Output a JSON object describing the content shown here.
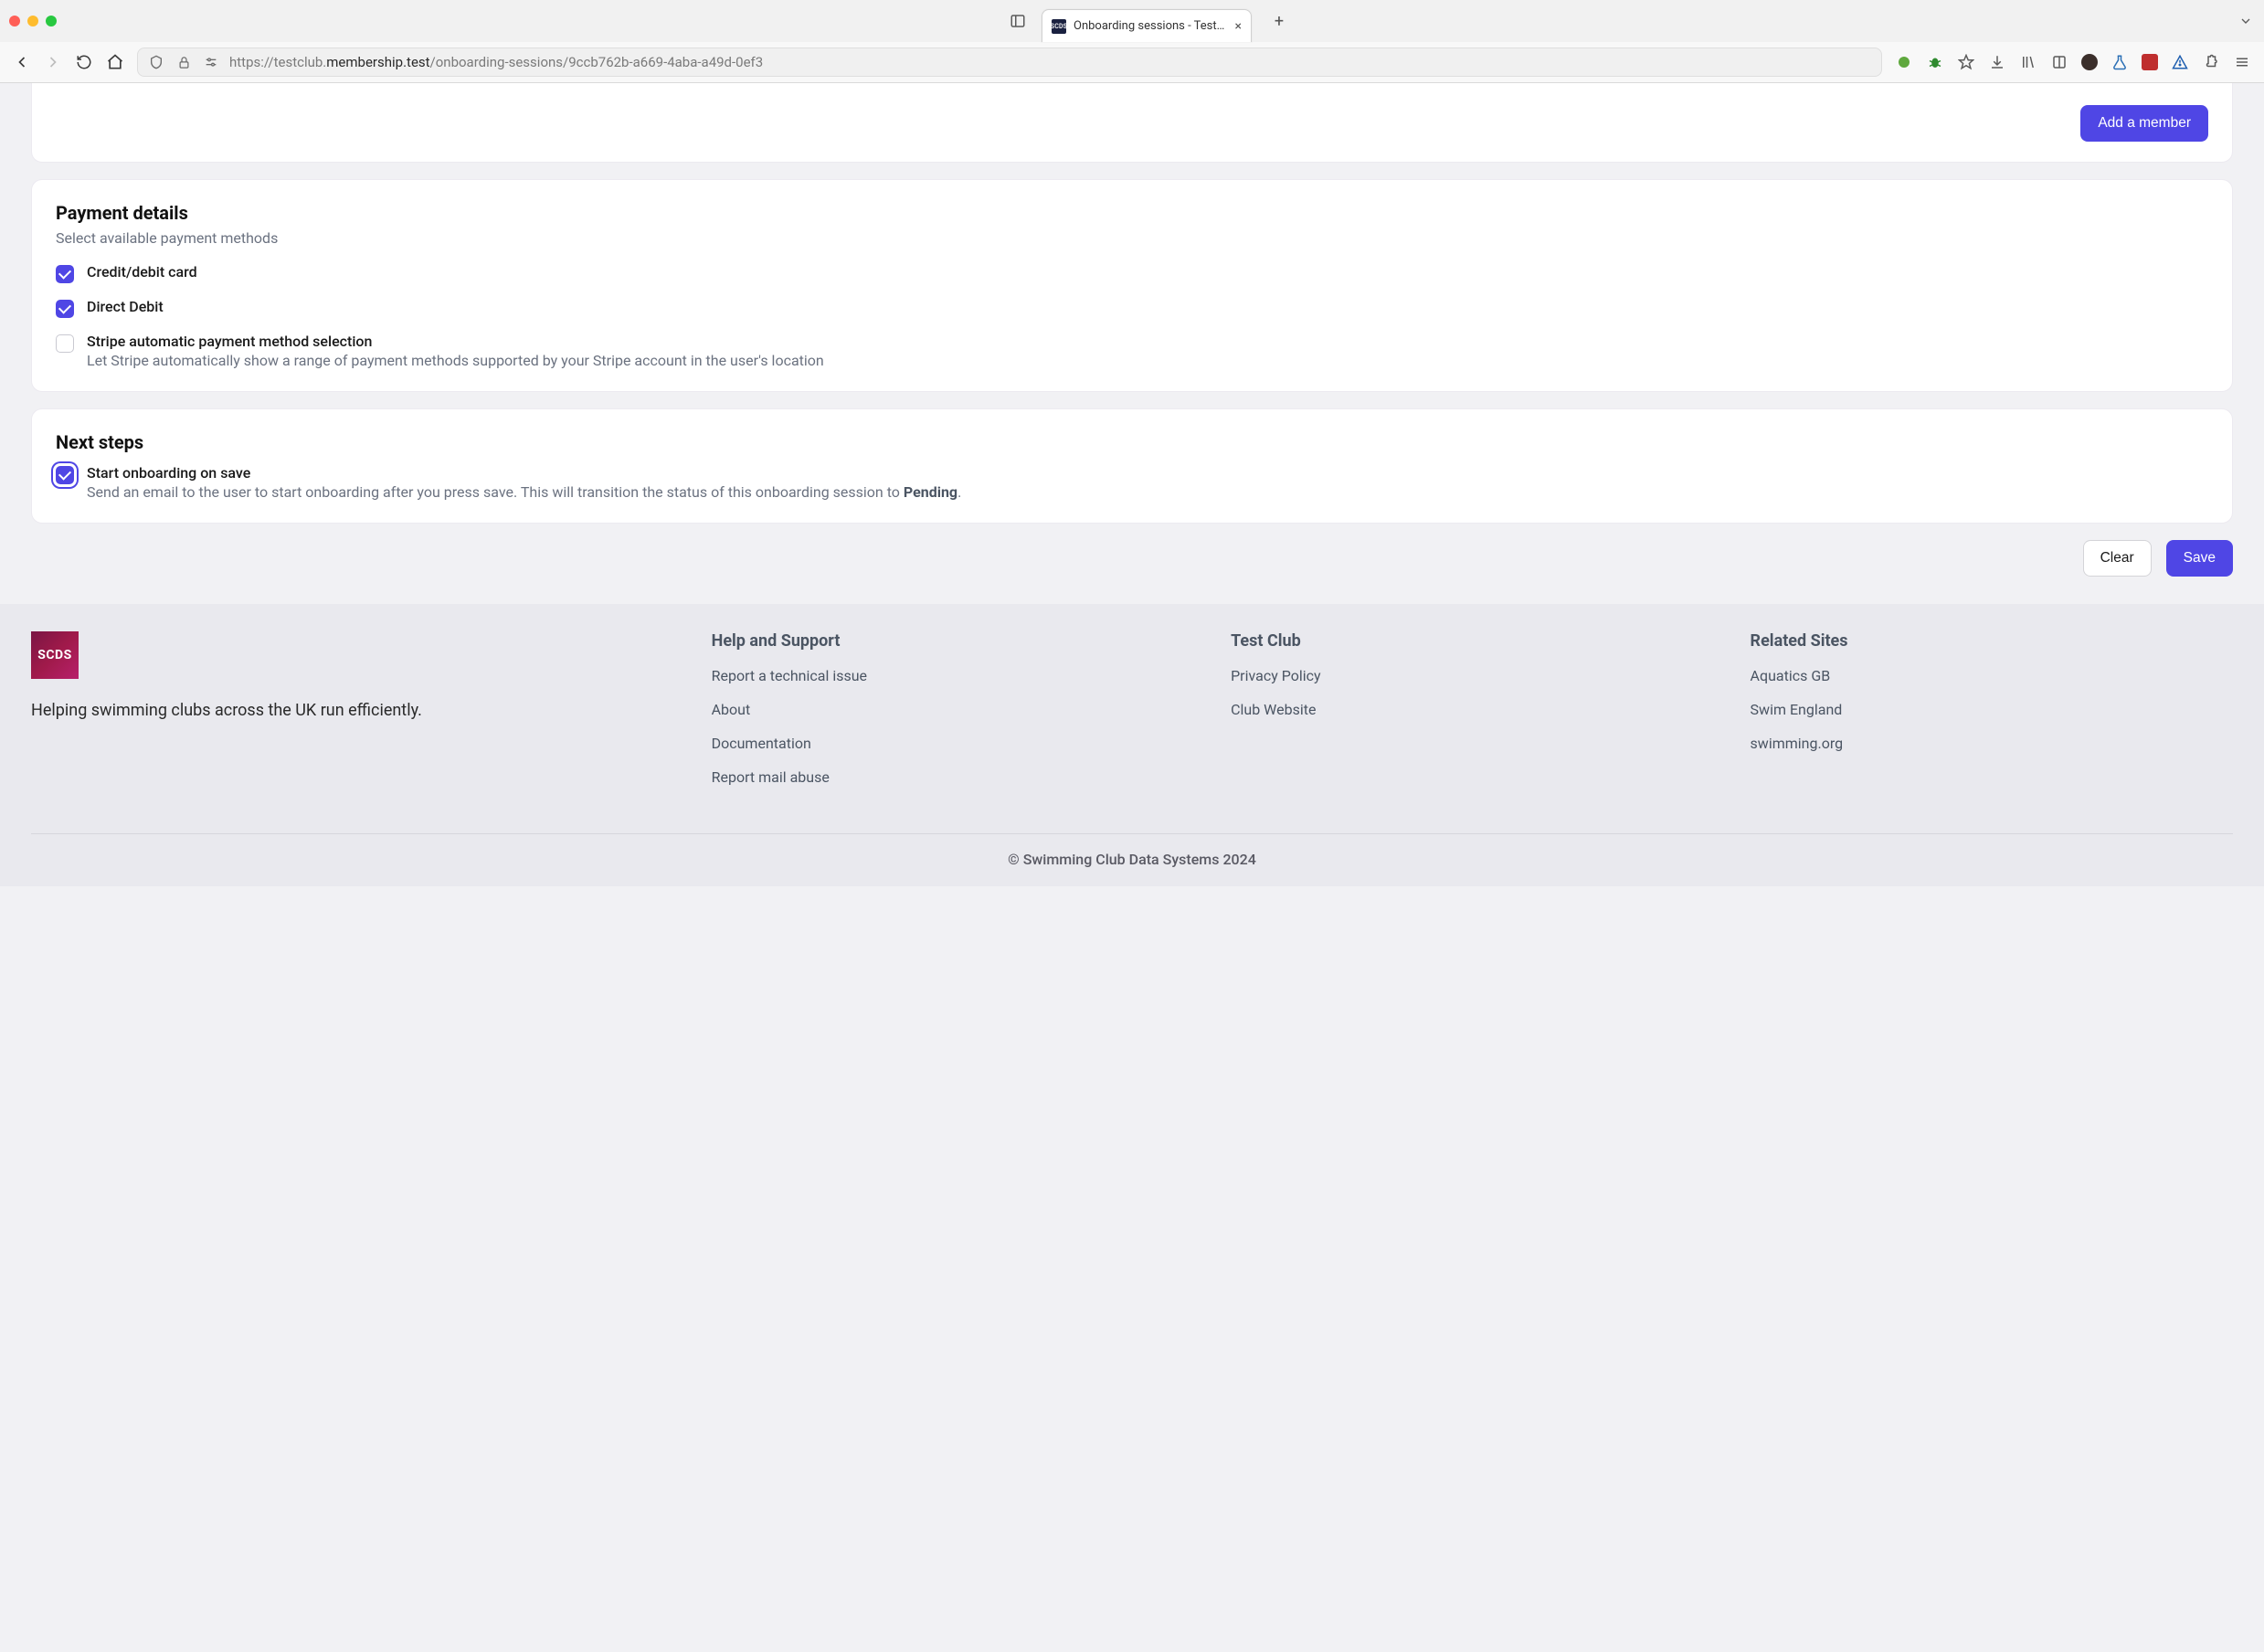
{
  "browser": {
    "tab_title": "Onboarding sessions - Test Clu",
    "favicon_text": "SCDS",
    "url_prefix": "https://testclub.",
    "url_emph": "membership.test",
    "url_suffix": "/onboarding-sessions/9ccb762b-a669-4aba-a49d-0ef3"
  },
  "top_card": {
    "add_member_label": "Add a member"
  },
  "payment_details": {
    "heading": "Payment details",
    "subheading": "Select available payment methods",
    "options": [
      {
        "label": "Credit/debit card",
        "desc": "",
        "checked": true
      },
      {
        "label": "Direct Debit",
        "desc": "",
        "checked": true
      },
      {
        "label": "Stripe automatic payment method selection",
        "desc": "Let Stripe automatically show a range of payment methods supported by your Stripe account in the user's location",
        "checked": false
      }
    ]
  },
  "next_steps": {
    "heading": "Next steps",
    "option": {
      "label": "Start onboarding on save",
      "desc_pre": "Send an email to the user to start onboarding after you press save. This will transition the status of this onboarding session to ",
      "desc_strong": "Pending",
      "desc_post": ".",
      "checked": true
    }
  },
  "actions": {
    "clear_label": "Clear",
    "save_label": "Save"
  },
  "footer": {
    "logo_text": "SCDS",
    "tagline": "Helping swimming clubs across the UK run efficiently.",
    "col1": {
      "heading": "Help and Support",
      "links": [
        "Report a technical issue",
        "About",
        "Documentation",
        "Report mail abuse"
      ]
    },
    "col2": {
      "heading": "Test Club",
      "links": [
        "Privacy Policy",
        "Club Website"
      ]
    },
    "col3": {
      "heading": "Related Sites",
      "links": [
        "Aquatics GB",
        "Swim England",
        "swimming.org"
      ]
    },
    "copyright": "© Swimming Club Data Systems 2024"
  }
}
